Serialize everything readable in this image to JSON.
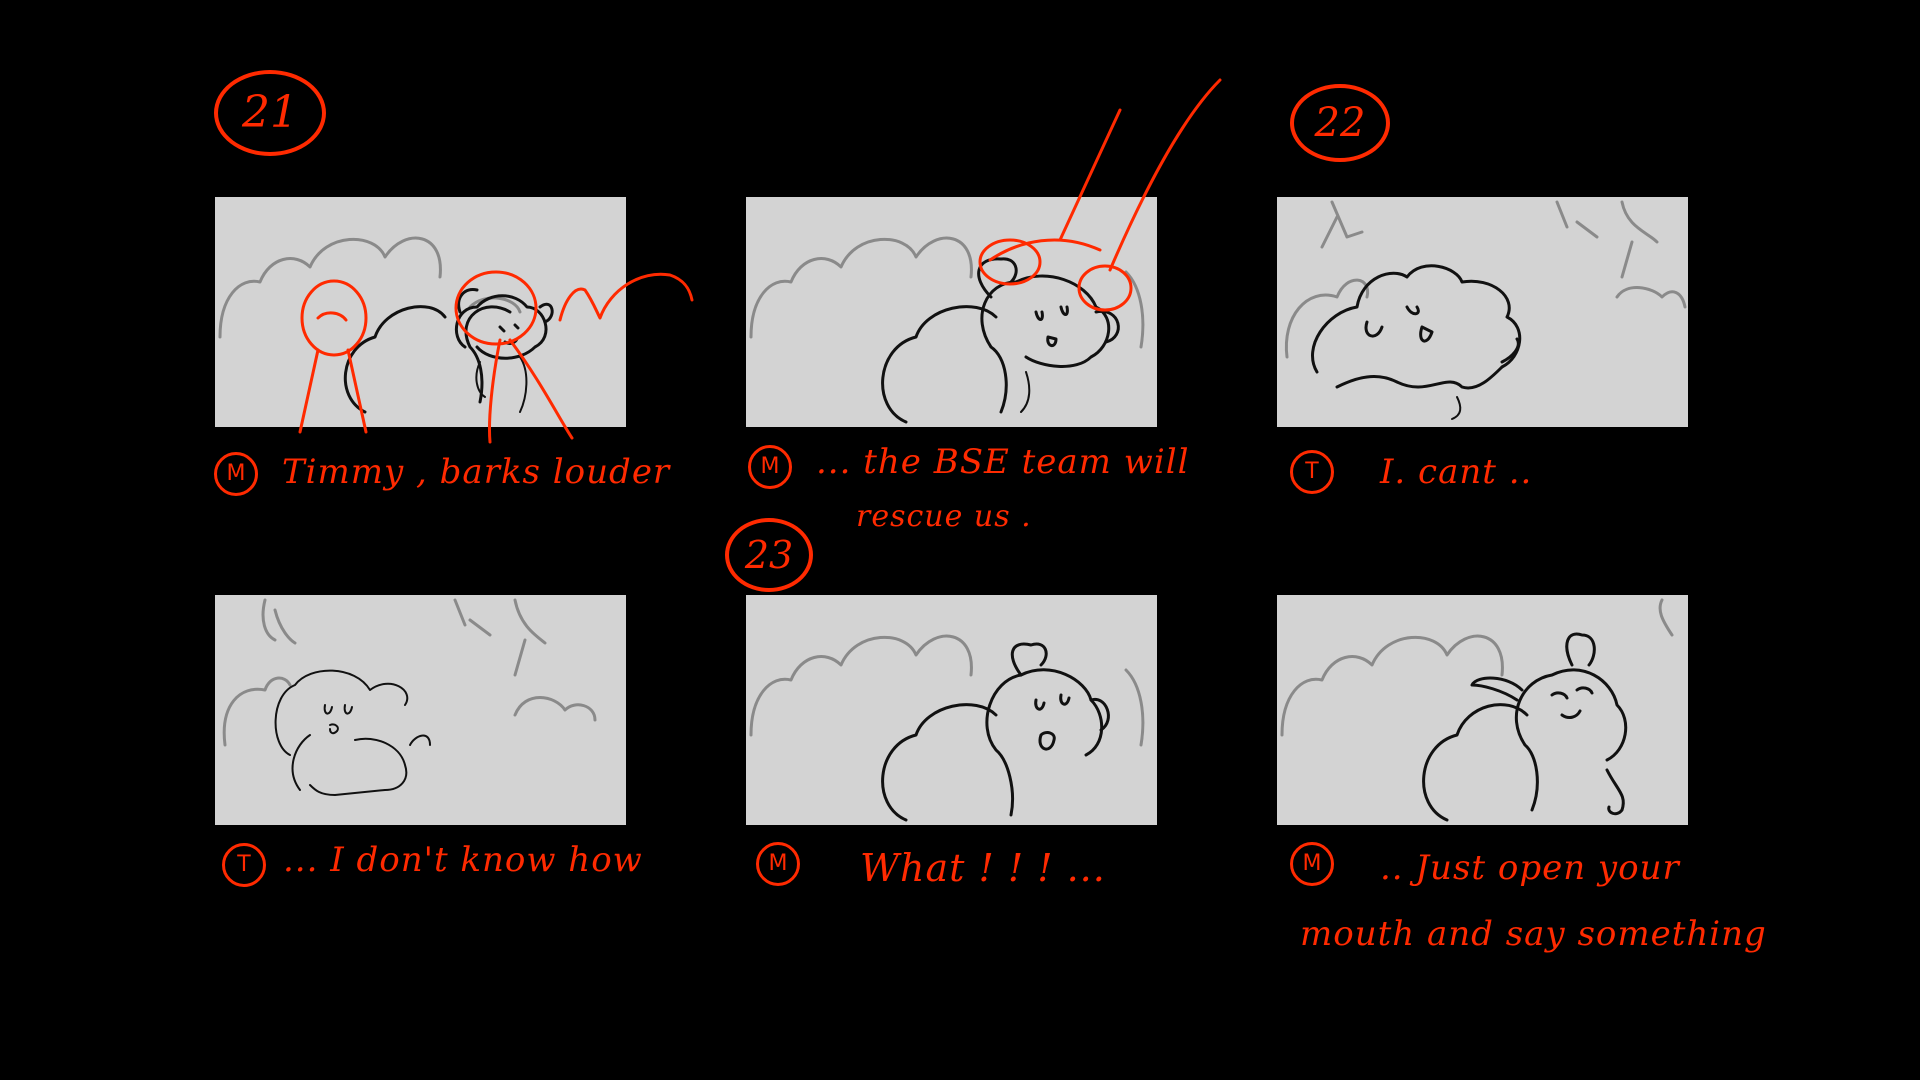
{
  "colors": {
    "background": "#000000",
    "panel": "#d3d3d3",
    "annotation": "#ff2a00"
  },
  "scenes": [
    "21",
    "22",
    "23"
  ],
  "panels": [
    {
      "speaker": "M",
      "dialogue": [
        "Timmy , barks louder"
      ]
    },
    {
      "speaker": "M",
      "dialogue": [
        "... the BSE team will",
        "rescue us ."
      ]
    },
    {
      "speaker": "T",
      "dialogue": [
        "I. cant .."
      ]
    },
    {
      "speaker": "T",
      "dialogue": [
        "... I don't know how"
      ]
    },
    {
      "speaker": "M",
      "dialogue": [
        "What ! ! ! ..."
      ]
    },
    {
      "speaker": "M",
      "dialogue": [
        ".. Just open your",
        "mouth and say something"
      ]
    }
  ]
}
